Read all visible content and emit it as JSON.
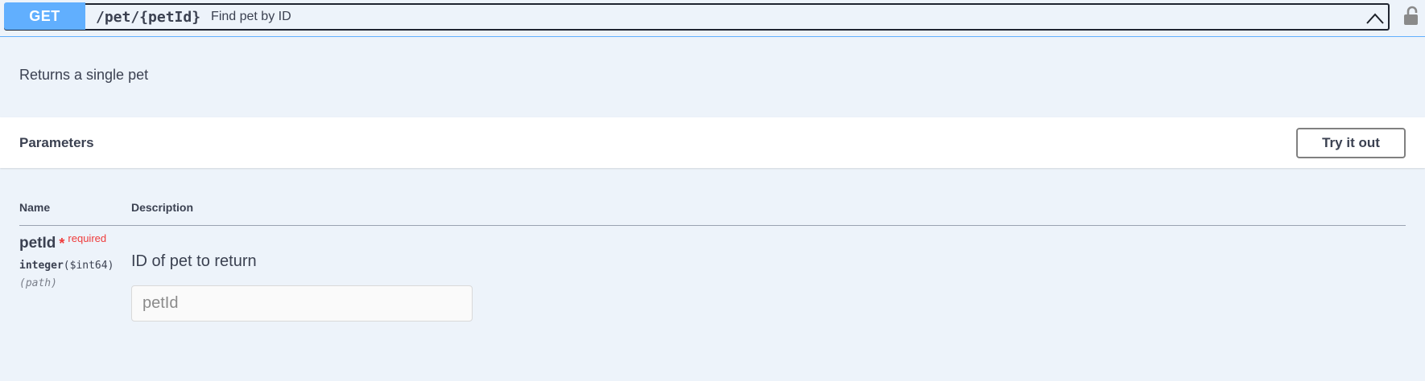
{
  "operation": {
    "method": "GET",
    "path": "/pet/{petId}",
    "summary": "Find pet by ID",
    "description": "Returns a single pet"
  },
  "parameters_section": {
    "title": "Parameters",
    "try_button": "Try it out",
    "columns": [
      "Name",
      "Description"
    ]
  },
  "parameter": {
    "name": "petId",
    "required_mark": "*",
    "required_label": "required",
    "type": "integer",
    "format": "($int64)",
    "location": "(path)",
    "description": "ID of pet to return",
    "placeholder": "petId",
    "value": ""
  },
  "colors": {
    "method_bg": "#61affe",
    "panel_bg": "#edf3fa",
    "required": "#ef3b3b"
  },
  "icons": {
    "collapse": "chevron-up-icon",
    "lock": "unlocked-padlock-icon"
  }
}
